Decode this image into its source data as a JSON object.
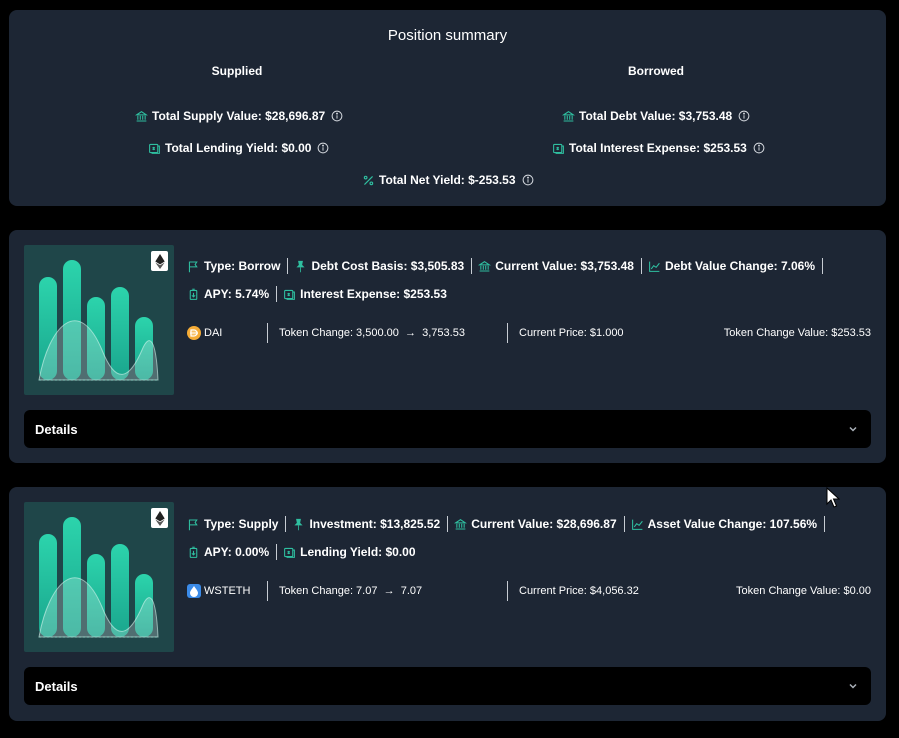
{
  "summary": {
    "title": "Position summary",
    "supplied_heading": "Supplied",
    "borrowed_heading": "Borrowed",
    "total_supply_value": "Total Supply Value: $28,696.87",
    "total_lending_yield": "Total Lending Yield: $0.00",
    "total_debt_value": "Total Debt Value: $3,753.48",
    "total_interest_expense": "Total Interest Expense: $253.53",
    "total_net_yield": "Total Net Yield: $-253.53"
  },
  "positions": [
    {
      "type": "Type: Borrow",
      "basis": "Debt Cost Basis: $3,505.83",
      "current_value": "Current Value: $3,753.48",
      "value_change": "Debt Value Change: 7.06%",
      "apy": "APY: 5.74%",
      "yield": "Interest Expense: $253.53",
      "token": "DAI",
      "token_change": "Token Change: 3,500.00",
      "token_change_to": "3,753.53",
      "current_price": "Current Price: $1.000",
      "token_change_value": "Token Change Value: $253.53",
      "details_label": "Details",
      "token_icon": "dai-coin-icon"
    },
    {
      "type": "Type: Supply",
      "basis": "Investment: $13,825.52",
      "current_value": "Current Value: $28,696.87",
      "value_change": "Asset Value Change: 107.56%",
      "apy": "APY: 0.00%",
      "yield": "Lending Yield: $0.00",
      "token": "WSTETH",
      "token_change": "Token Change: 7.07",
      "token_change_to": "7.07",
      "current_price": "Current Price: $4,056.32",
      "token_change_value": "Token Change Value: $0.00",
      "details_label": "Details",
      "token_icon": "wsteth-drop-icon"
    }
  ],
  "colors": {
    "card_bg": "#1d2634",
    "accent": "#2fbfa0",
    "page_bg": "#000000",
    "thumb_bg": "#1f4649"
  }
}
